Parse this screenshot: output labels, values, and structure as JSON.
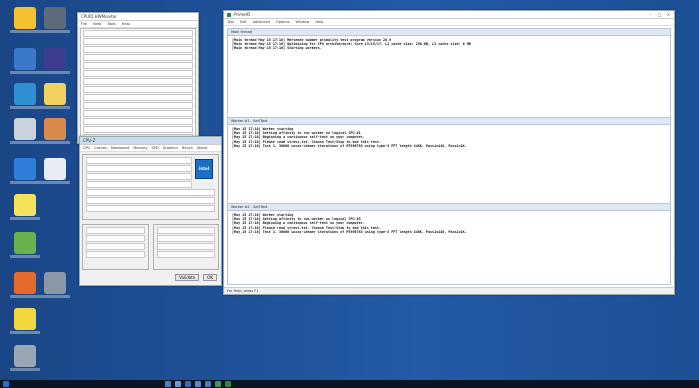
{
  "monitor_window": {
    "title": "Prime95",
    "menu": [
      "Test",
      "Edit",
      "Advanced",
      "Options",
      "Window",
      "Help"
    ],
    "main_panel": {
      "title": "Main thread",
      "lines": [
        "[Main thread May 15 17:10] Mersenne number primality test program version 28.9",
        "[Main thread May 15 17:10] Optimizing for CPU architecture: Core i3/i5/i7, L2 cache size: 256 KB, L3 cache size: 6 MB",
        "[Main thread May 15 17:10] Starting workers."
      ]
    },
    "worker1_panel": {
      "title": "Worker #1 - Self-Test",
      "lines": [
        "[May 15 17:10] Worker starting",
        "[May 15 17:10] Setting affinity to run worker on logical CPU #1",
        "[May 15 17:10] Beginning a continuous self-test on your computer.",
        "[May 15 17:10] Please read stress.txt. Choose Test/Stop to end this test.",
        "[May 15 17:10] Test 1, 36000 Lucas-Lehmer iterations of M7998783 using type-3 FFT length 448K, Pass1=448, Pass2=1K."
      ]
    },
    "worker2_panel": {
      "title": "Worker #2 - Self-Test",
      "lines": [
        "[May 15 17:10] Worker starting",
        "[May 15 17:10] Setting affinity to run worker on logical CPU #3",
        "[May 15 17:10] Beginning a continuous self-test on your computer.",
        "[May 15 17:10] Please read stress.txt. Choose Test/Stop to end this test.",
        "[May 15 17:10] Test 1, 36000 Lucas-Lehmer iterations of M7998783 using type-3 FFT length 448K, Pass1=448, Pass2=1K."
      ]
    },
    "status": "For Help, press F1"
  },
  "hwmon_window": {
    "title": "CPUID HWMonitor",
    "menu": [
      "File",
      "View",
      "Tools",
      "Help"
    ]
  },
  "cpuz_window": {
    "title": "CPU-Z",
    "tabs": [
      "CPU",
      "Caches",
      "Mainboard",
      "Memory",
      "SPD",
      "Graphics",
      "Bench",
      "About"
    ],
    "brand": "intel",
    "buttons": [
      "Validate",
      "OK"
    ]
  },
  "colors": {
    "desktop": "#1f4f91",
    "taskbar": "#0b1424",
    "panel_head": "#dfe8f5"
  }
}
